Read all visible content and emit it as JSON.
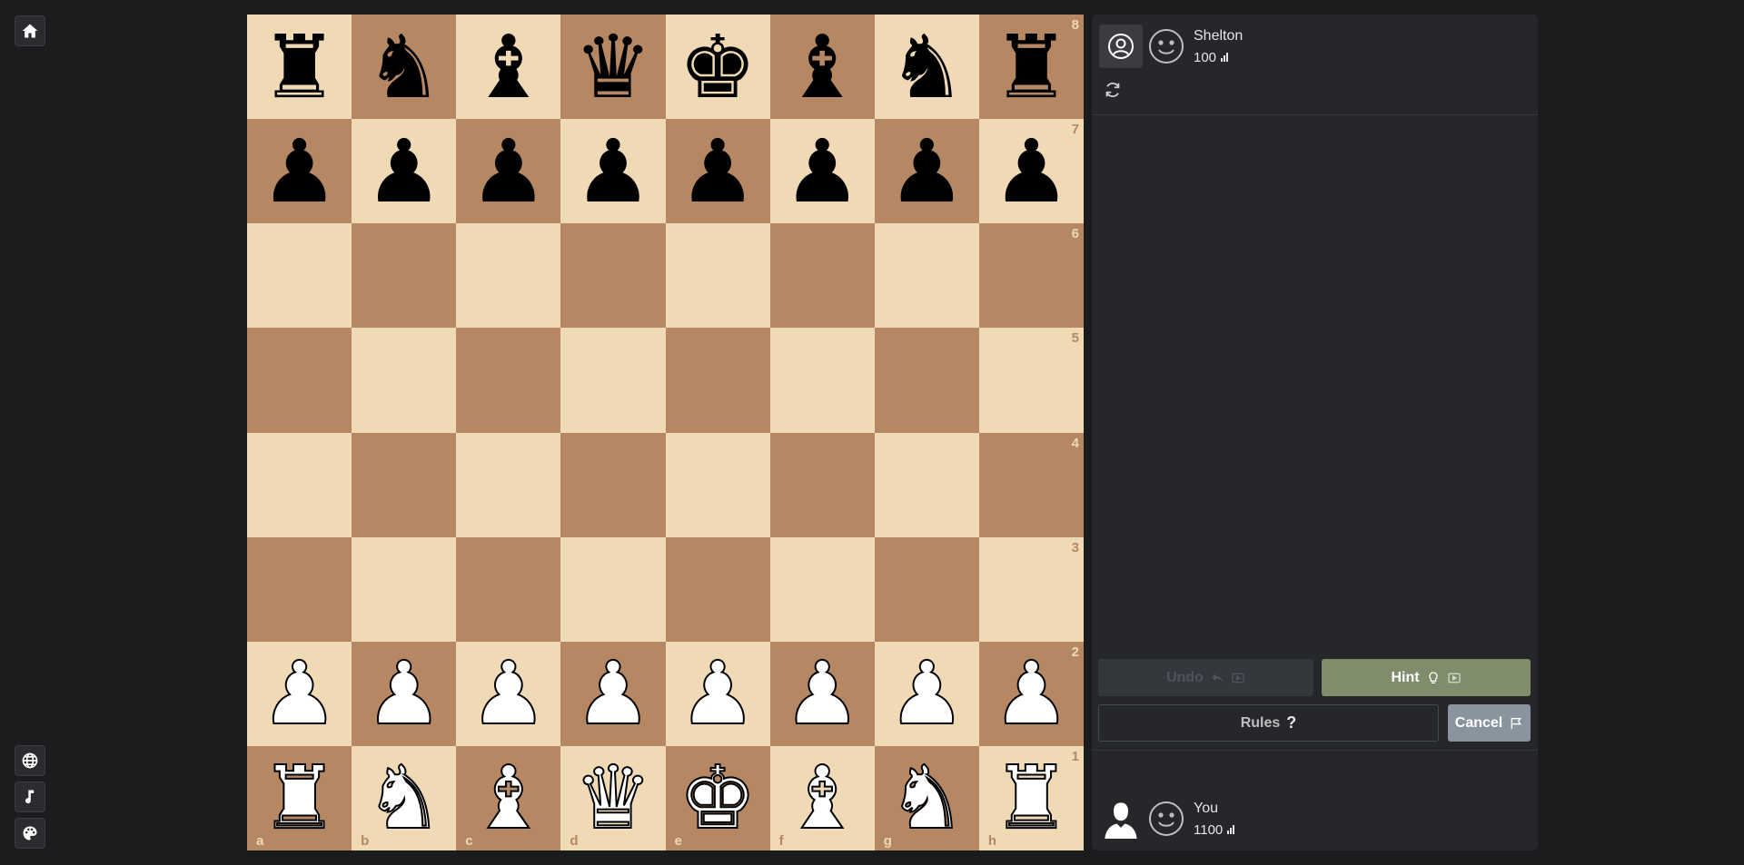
{
  "nav": {
    "home_icon": "home-icon",
    "language_icon": "globe-icon",
    "music_icon": "music-note-icon",
    "theme_icon": "palette-icon"
  },
  "board": {
    "ranks": [
      "8",
      "7",
      "6",
      "5",
      "4",
      "3",
      "2",
      "1"
    ],
    "files": [
      "a",
      "b",
      "c",
      "d",
      "e",
      "f",
      "g",
      "h"
    ],
    "position": [
      [
        "♜",
        "♞",
        "♝",
        "♛",
        "♚",
        "♝",
        "♞",
        "♜"
      ],
      [
        "♟",
        "♟",
        "♟",
        "♟",
        "♟",
        "♟",
        "♟",
        "♟"
      ],
      [
        "",
        "",
        "",
        "",
        "",
        "",
        "",
        ""
      ],
      [
        "",
        "",
        "",
        "",
        "",
        "",
        "",
        ""
      ],
      [
        "",
        "",
        "",
        "",
        "",
        "",
        "",
        ""
      ],
      [
        "",
        "",
        "",
        "",
        "",
        "",
        "",
        ""
      ],
      [
        "♟",
        "♟",
        "♟",
        "♟",
        "♟",
        "♟",
        "♟",
        "♟"
      ],
      [
        "♜",
        "♞",
        "♝",
        "♛",
        "♚",
        "♝",
        "♞",
        "♜"
      ]
    ],
    "piece_colors": [
      [
        "b",
        "b",
        "b",
        "b",
        "b",
        "b",
        "b",
        "b"
      ],
      [
        "b",
        "b",
        "b",
        "b",
        "b",
        "b",
        "b",
        "b"
      ],
      [
        "",
        "",
        "",
        "",
        "",
        "",
        "",
        ""
      ],
      [
        "",
        "",
        "",
        "",
        "",
        "",
        "",
        ""
      ],
      [
        "",
        "",
        "",
        "",
        "",
        "",
        "",
        ""
      ],
      [
        "",
        "",
        "",
        "",
        "",
        "",
        "",
        ""
      ],
      [
        "w",
        "w",
        "w",
        "w",
        "w",
        "w",
        "w",
        "w"
      ],
      [
        "w",
        "w",
        "w",
        "w",
        "w",
        "w",
        "w",
        "w"
      ]
    ],
    "light_color": "#f0d9b5",
    "dark_color": "#b58863"
  },
  "opponent": {
    "name": "Shelton",
    "rating": "100"
  },
  "player": {
    "name": "You",
    "rating": "1100"
  },
  "controls": {
    "undo_label": "Undo",
    "hint_label": "Hint",
    "rules_label": "Rules",
    "cancel_label": "Cancel"
  }
}
